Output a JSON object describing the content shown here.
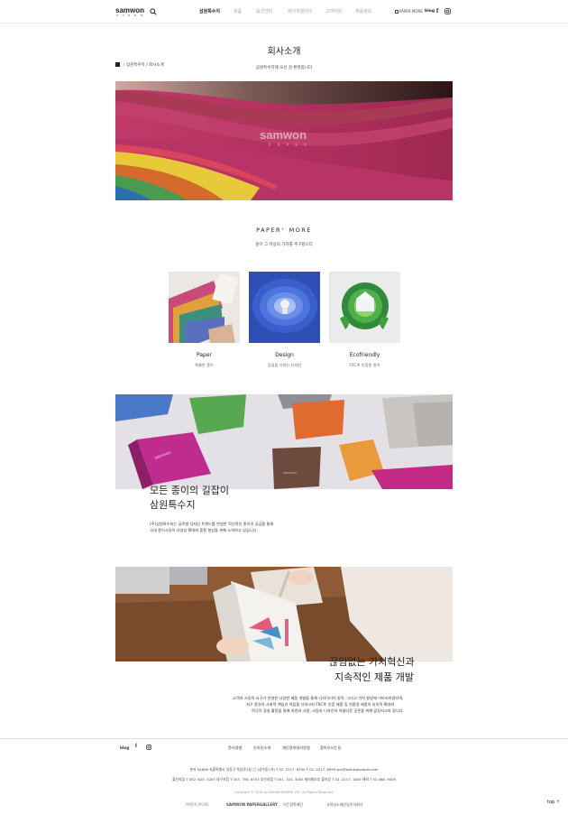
{
  "header": {
    "logo": "samwon",
    "logo_sub": "P A P E R",
    "nav": [
      "삼원특수지",
      "제품",
      "옵션센터",
      "페이퍼갤러리",
      "고객지원",
      "채용정보"
    ],
    "paper_more": "PAPER MORE",
    "blog": "blog"
  },
  "page": {
    "title": "회사소개",
    "subtitle": "삼원특수지에 오신 걸 환영합니다",
    "breadcrumb": "/ 삼원특수지 / 회사소개"
  },
  "banner1": {
    "watermark": "samwon",
    "watermark_sub": "P A P E R"
  },
  "section": {
    "title": "PAPER⁺ MORE",
    "subtitle": "종이 그 이상의 가치를 추구합니다"
  },
  "cards": [
    {
      "title": "Paper",
      "sub": "특별한 종이"
    },
    {
      "title": "Design",
      "sub": "감성을 더하는 디자인"
    },
    {
      "title": "Ecofriendly",
      "sub": "FSC® 인증된 종이"
    }
  ],
  "block1": {
    "headline1": "모든 종이의 길잡이",
    "headline2": "삼원특수지",
    "p1": "(주)삼원특수지는 글로벌 디자인 트랜드를 반영한 혁신적인 종이의 공급을 통해",
    "p2": "국내 종이시장의 다양성 확대와 품질 향상을 위해 노력하고 있습니다."
  },
  "block2": {
    "headline1": "끊임없는 가치혁신과",
    "headline2": "지속적인 제품 개발",
    "p1": "고객과 시장의 요구가 반영된 다양한 제품 개발을 통해 디자이너의 창작, 그리고 가치 향상에 이바지하였으며,",
    "p2": "지구 환경의 사회적 책임과 역할을 다하고자 FSC® 인증 제품 및 친환경 제품의 지속적 확대와",
    "p3": "적극적 경영 활동을 통해 자연과 사람, 사람과 디자인의 아름다운 공존을 위해 앞장서고자 합니다."
  },
  "footer": {
    "blog": "blog",
    "links": [
      "윤리경영",
      "온라인소개",
      "개인정보처리방침",
      "찾아오시는길"
    ],
    "address": "본사  04808 서울특별시 성동구 뚝섬로1길 ◯ (성수동1가)  T 02. 2217. 8700  F 02. 2217. 8999  spc@samwonpaper.com",
    "branches": "울산지점  T 052. 625. 3283    대구지점  T 053. 756. 8703    부산지점  T 051. 315. 3283    제지제조부 출하장  T 02. 2217. 1849    해외  T 02.468. 9009",
    "copyright": "Copyright © 2018 by SAMWONPAPER LTD. All Rights Reserved.",
    "brands": [
      "PAPER MORE",
      "SAMWON PAPERGALLERY",
      "이든장학재단",
      "고려산소재산업주식회사"
    ],
    "top": "top ↑"
  },
  "colors": {
    "text": "#222222",
    "muted": "#aaaaaa",
    "border": "#dddddd"
  }
}
